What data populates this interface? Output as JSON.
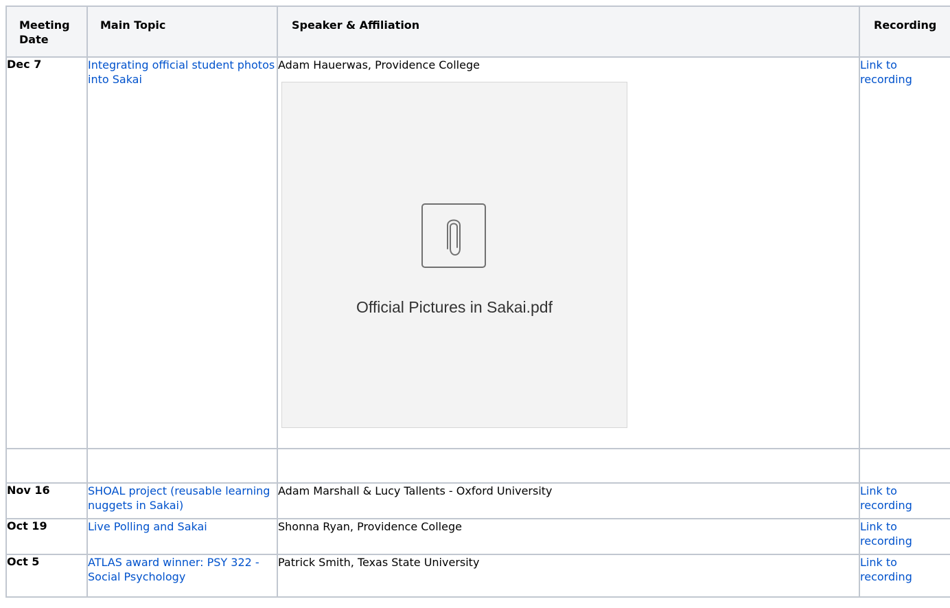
{
  "table": {
    "headers": {
      "date": "Meeting Date",
      "topic": "Main Topic",
      "speaker": "Speaker & Affiliation",
      "recording": "Recording"
    },
    "rows": [
      {
        "date": "Dec 7",
        "topic": "Integrating official student photos into Sakai",
        "speaker": "Adam Hauerwas, Providence College",
        "recording": "Link to recording",
        "attachment": {
          "filename": "Official Pictures in Sakai.pdf",
          "icon": "paperclip-icon"
        }
      },
      {
        "date": "",
        "topic": "",
        "speaker": "",
        "recording": ""
      },
      {
        "date": "Nov 16",
        "topic": "SHOAL project (reusable learning nuggets in Sakai)",
        "speaker": "Adam Marshall & Lucy Tallents - Oxford University",
        "recording": "Link to recording"
      },
      {
        "date": "Oct 19",
        "topic": "Live Polling and Sakai",
        "speaker": "Shonna Ryan, Providence College",
        "recording": "Link to recording"
      },
      {
        "date": "Oct 5",
        "topic": "ATLAS award winner: PSY 322 - Social Psychology",
        "speaker": "Patrick Smith, Texas State University",
        "recording": "Link to recording"
      }
    ]
  },
  "colors": {
    "link": "#0052cc",
    "header_bg": "#f4f5f7",
    "border": "#c1c7d0",
    "attachment_bg": "#f3f3f3"
  }
}
